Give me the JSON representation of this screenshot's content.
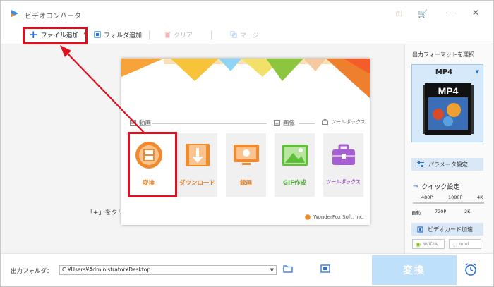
{
  "app": {
    "title": "ビデオコンバータ"
  },
  "toolbar": {
    "add_file": "ファイル追加",
    "add_folder": "フォルダ追加",
    "clear": "クリア",
    "merge": "マージ"
  },
  "main": {
    "hint": "「+」をクリッ"
  },
  "popup": {
    "sections": {
      "video": "動画",
      "image": "画像",
      "toolbox": "ツールボックス"
    },
    "tiles": [
      {
        "label": "変換",
        "icon": "film-icon"
      },
      {
        "label": "ダウンロード",
        "icon": "download-icon"
      },
      {
        "label": "録画",
        "icon": "screen-record-icon"
      },
      {
        "label": "GIF作成",
        "icon": "image-icon"
      },
      {
        "label": "ツールボックス",
        "icon": "toolbox-icon"
      }
    ],
    "copyright": "WonderFox Soft, Inc."
  },
  "right_panel": {
    "title": "出力フォーマットを選択",
    "format": "MP4",
    "format_badge": "MP4",
    "params_button": "パラメータ設定",
    "quick_settings": "クイック設定",
    "scale_top": [
      "480P",
      "1080P",
      "4K"
    ],
    "scale_bottom": [
      "自動",
      "720P",
      "2K"
    ],
    "gpu_accel": "ビデオカード加速",
    "gpu_vendors": [
      "NVIDIA",
      "Intel"
    ]
  },
  "bottom": {
    "output_label": "出力フォルダ：",
    "output_path": "C:¥Users¥Administrator¥Desktop",
    "convert_button": "変換"
  },
  "colors": {
    "accent_blue": "#2a6fd6",
    "orange": "#f08a2c",
    "annotation_red": "#e0101f",
    "convert_button": "#bfe0fb"
  }
}
